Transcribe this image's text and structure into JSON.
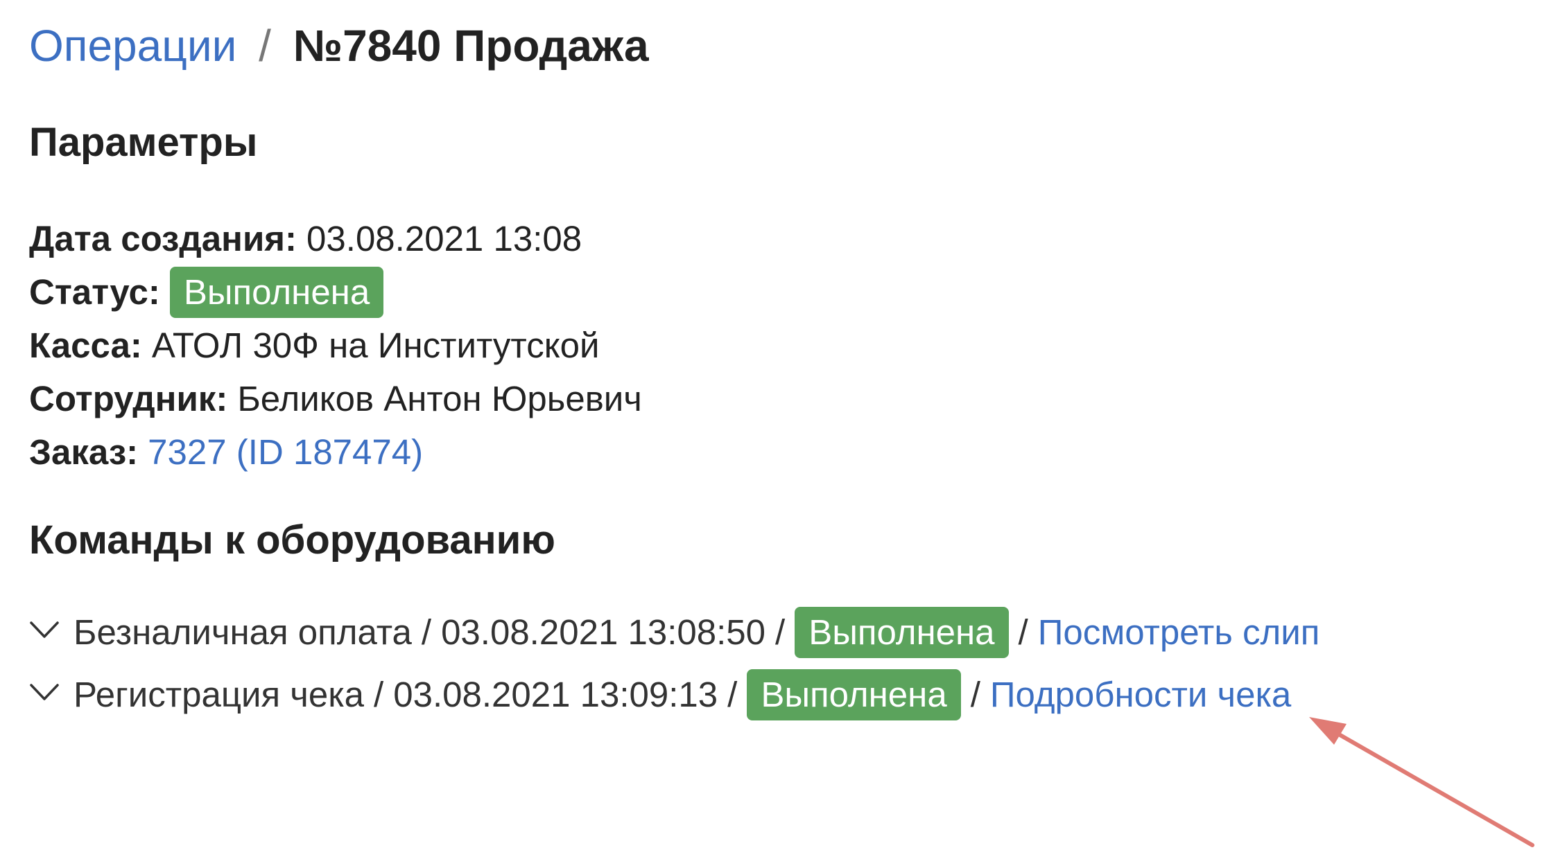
{
  "breadcrumb": {
    "parent": "Операции",
    "separator": "/",
    "current": "№7840 Продажа"
  },
  "params": {
    "title": "Параметры",
    "created": {
      "label": "Дата создания:",
      "value": "03.08.2021 13:08"
    },
    "status": {
      "label": "Статус:",
      "value": "Выполнена"
    },
    "cashier": {
      "label": "Касса:",
      "value": "АТОЛ 30Ф на Институтской"
    },
    "employee": {
      "label": "Сотрудник:",
      "value": "Беликов Антон Юрьевич"
    },
    "order": {
      "label": "Заказ:",
      "value": "7327 (ID 187474)"
    }
  },
  "commands": {
    "title": "Команды к оборудованию",
    "items": [
      {
        "name": "Безналичная оплата",
        "datetime": "03.08.2021 13:08:50",
        "status": "Выполнена",
        "link": "Посмотреть слип"
      },
      {
        "name": "Регистрация чека",
        "datetime": "03.08.2021 13:09:13",
        "status": "Выполнена",
        "link": "Подробности чека"
      }
    ]
  },
  "colors": {
    "link": "#3c6fc2",
    "badge": "#5ba35c",
    "annotation_arrow": "#e07b74"
  },
  "icons": {
    "chevron": "chevron-down-icon",
    "annotation": "arrow-annotation-icon"
  }
}
